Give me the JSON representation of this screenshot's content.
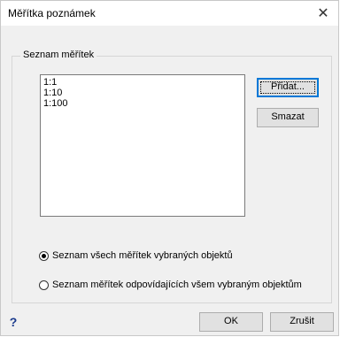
{
  "window": {
    "title": "Měřítka poznámek",
    "close_glyph": "✕"
  },
  "group": {
    "label": "Seznam měřítek",
    "items": [
      "1:1",
      "1:10",
      "1:100"
    ]
  },
  "side_buttons": {
    "add": "Přidat...",
    "delete": "Smazat"
  },
  "options": {
    "selected_index": 0,
    "option_all": "Seznam všech měřítek vybraných objektů",
    "option_common": "Seznam měřítek odpovídajících všem vybraným objektům"
  },
  "footer": {
    "help": "?",
    "ok": "OK",
    "cancel": "Zrušit"
  }
}
